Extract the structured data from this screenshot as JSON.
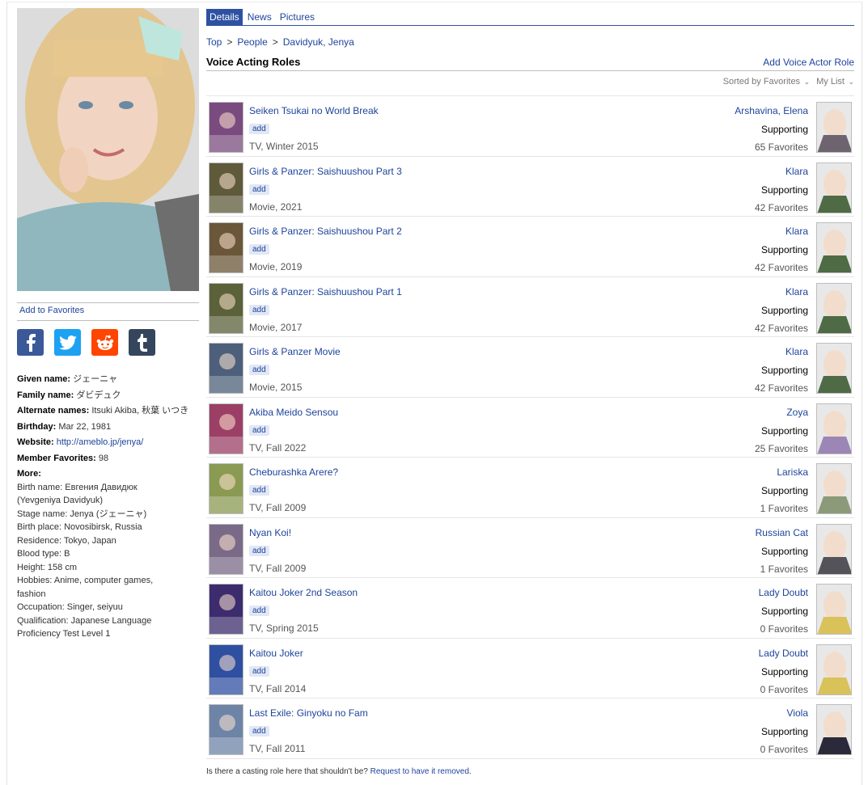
{
  "tabs": [
    "Details",
    "News",
    "Pictures"
  ],
  "breadcrumb": {
    "top": "Top",
    "people": "People",
    "current": "Davidyuk, Jenya"
  },
  "left": {
    "add_favorites": "Add to Favorites",
    "social": [
      {
        "name": "facebook",
        "color": "#3b5998",
        "glyph": "f"
      },
      {
        "name": "twitter",
        "color": "#1da1f2",
        "glyph": "t"
      },
      {
        "name": "reddit",
        "color": "#ff4500",
        "glyph": "r"
      },
      {
        "name": "tumblr",
        "color": "#35465c",
        "glyph": "t"
      }
    ],
    "given_label": "Given name:",
    "given_value": " ジェーニャ",
    "family_label": "Family name:",
    "family_value": " ダビデュク",
    "alt_label": "Alternate names:",
    "alt_value": " Itsuki Akiba, 秋葉 いつき",
    "birthday_label": "Birthday:",
    "birthday_value": " Mar 22, 1981",
    "website_label": "Website:",
    "website_value": "http://ameblo.jp/jenya/",
    "members_label": "Member Favorites:",
    "members_value": " 98",
    "more_label": "More:",
    "more_lines": [
      "Birth name: Евгения Давидюк",
      "(Yevgeniya Davidyuk)",
      "Stage name: Jenya (ジェーニャ)",
      "Birth place: Novosibirsk, Russia",
      "Residence: Tokyo, Japan",
      "Blood type: B",
      "Height: 158 cm",
      "Hobbies: Anime, computer games,",
      "fashion",
      "Occupation: Singer, seiyuu",
      "Qualification: Japanese Language",
      "Proficiency Test Level 1"
    ]
  },
  "section": {
    "title": "Voice Acting Roles",
    "action": "Add Voice Actor Role"
  },
  "sort": {
    "sorted": "Sorted by Favorites",
    "mylist": "My List"
  },
  "add_label": "add",
  "roles": [
    {
      "anime": "Seiken Tsukai no World Break",
      "meta": "TV, Winter 2015",
      "character": "Arshavina, Elena",
      "role": "Supporting",
      "favorites": "65 Favorites",
      "ac": "#7a4b7e",
      "cc": "#6d6470"
    },
    {
      "anime": "Girls & Panzer: Saishuushou Part 3",
      "meta": "Movie, 2021",
      "character": "Klara",
      "role": "Supporting",
      "favorites": "42 Favorites",
      "ac": "#5e5a3a",
      "cc": "#4f6b45"
    },
    {
      "anime": "Girls & Panzer: Saishuushou Part 2",
      "meta": "Movie, 2019",
      "character": "Klara",
      "role": "Supporting",
      "favorites": "42 Favorites",
      "ac": "#6a5638",
      "cc": "#4f6b45"
    },
    {
      "anime": "Girls & Panzer: Saishuushou Part 1",
      "meta": "Movie, 2017",
      "character": "Klara",
      "role": "Supporting",
      "favorites": "42 Favorites",
      "ac": "#5b6138",
      "cc": "#4f6b45"
    },
    {
      "anime": "Girls & Panzer Movie",
      "meta": "Movie, 2015",
      "character": "Klara",
      "role": "Supporting",
      "favorites": "42 Favorites",
      "ac": "#4d5f7a",
      "cc": "#4f6b45"
    },
    {
      "anime": "Akiba Meido Sensou",
      "meta": "TV, Fall 2022",
      "character": "Zoya",
      "role": "Supporting",
      "favorites": "25 Favorites",
      "ac": "#9b3f66",
      "cc": "#9c86b5"
    },
    {
      "anime": "Cheburashka Arere?",
      "meta": "TV, Fall 2009",
      "character": "Lariska",
      "role": "Supporting",
      "favorites": "1 Favorites",
      "ac": "#8a9a52",
      "cc": "#8c9a7a"
    },
    {
      "anime": "Nyan Koi!",
      "meta": "TV, Fall 2009",
      "character": "Russian Cat",
      "role": "Supporting",
      "favorites": "1 Favorites",
      "ac": "#7a6a88",
      "cc": "#55535a"
    },
    {
      "anime": "Kaitou Joker 2nd Season",
      "meta": "TV, Spring 2015",
      "character": "Lady Doubt",
      "role": "Supporting",
      "favorites": "0 Favorites",
      "ac": "#3c2c6e",
      "cc": "#d9c25a"
    },
    {
      "anime": "Kaitou Joker",
      "meta": "TV, Fall 2014",
      "character": "Lady Doubt",
      "role": "Supporting",
      "favorites": "0 Favorites",
      "ac": "#2f4fa0",
      "cc": "#d9c25a"
    },
    {
      "anime": "Last Exile: Ginyoku no Fam",
      "meta": "TV, Fall 2011",
      "character": "Viola",
      "role": "Supporting",
      "favorites": "0 Favorites",
      "ac": "#6d84a6",
      "cc": "#2a2a3a"
    }
  ],
  "footnote": {
    "text": "Is there a casting role here that shouldn't be? ",
    "link": "Request to have it removed",
    "end": "."
  }
}
